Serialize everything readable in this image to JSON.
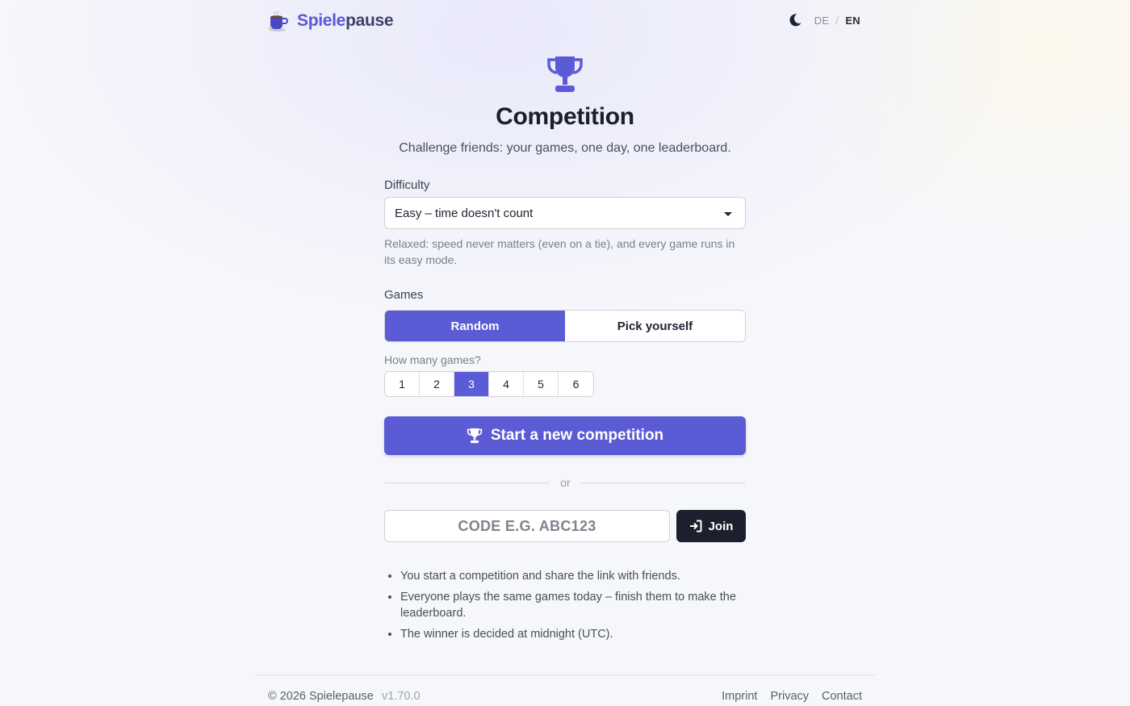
{
  "header": {
    "brand_part1": "Spiele",
    "brand_part2": "pause",
    "lang_de": "DE",
    "lang_sep": "/",
    "lang_en": "EN"
  },
  "hero": {
    "title": "Competition",
    "subtitle": "Challenge friends: your games, one day, one leaderboard."
  },
  "difficulty": {
    "label": "Difficulty",
    "selected": "Easy – time doesn't count",
    "hint": "Relaxed: speed never matters (even on a tie), and every game runs in its easy mode."
  },
  "games": {
    "label": "Games",
    "mode_random": "Random",
    "mode_pick": "Pick yourself",
    "selected_mode": "Random",
    "count_label": "How many games?",
    "counts": [
      "1",
      "2",
      "3",
      "4",
      "5",
      "6"
    ],
    "selected_count": "3"
  },
  "actions": {
    "start_label": "Start a new competition",
    "or_label": "or",
    "code_placeholder": "CODE E.G. ABC123",
    "join_label": "Join"
  },
  "info": [
    "You start a competition and share the link with friends.",
    "Everyone plays the same games today – finish them to make the leaderboard.",
    "The winner is decided at midnight (UTC)."
  ],
  "footer": {
    "copyright": "© 2026 Spielepause",
    "version": "v1.70.0",
    "links": [
      "Imprint",
      "Privacy",
      "Contact"
    ]
  },
  "colors": {
    "accent": "#5b5bd6",
    "dark_button": "#1c1f2e",
    "brand_primary": "#5a58d6",
    "brand_secondary": "#3f4268"
  },
  "icons": {
    "logo": "coffee-mug-icon",
    "theme": "moon-icon",
    "hero": "trophy-icon",
    "start": "trophy-icon",
    "join": "sign-in-icon"
  }
}
